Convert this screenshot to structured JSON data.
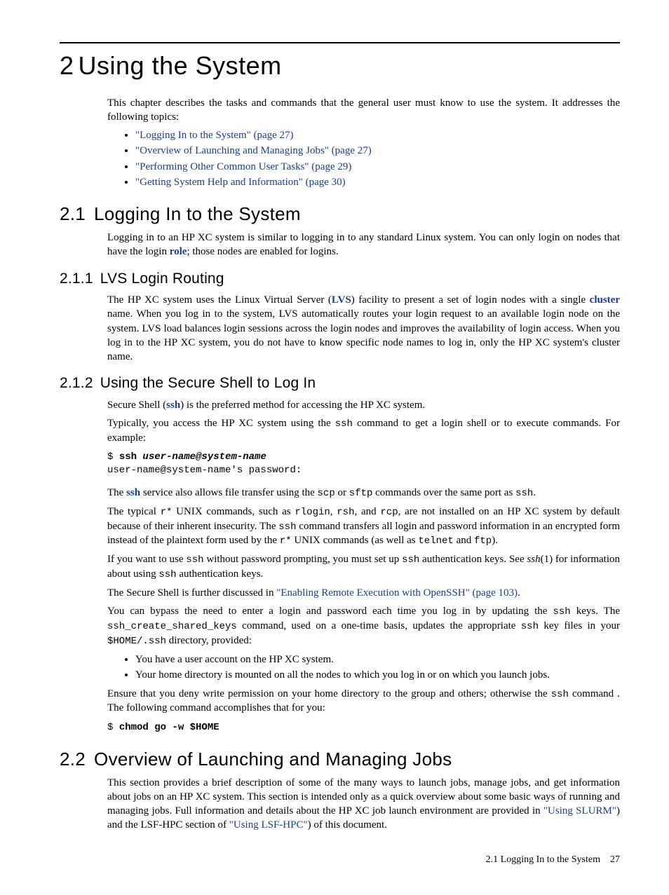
{
  "chapter": {
    "number": "2",
    "title": "Using the System",
    "intro": "This chapter describes the tasks and commands that the general user must know to use the system. It addresses the following topics:",
    "toc": [
      "\"Logging In to the System\" (page 27)",
      "\"Overview of Launching and Managing Jobs\" (page 27)",
      "\"Performing Other Common User Tasks\" (page 29)",
      "\"Getting System Help and Information\" (page 30)"
    ]
  },
  "s21": {
    "number": "2.1",
    "title": "Logging In to the System",
    "p1a": "Logging in to an HP XC system is similar to logging in to any standard Linux system. You can only login on nodes that have the login ",
    "p1_link": "role",
    "p1b": "; those nodes are enabled for logins."
  },
  "s211": {
    "number": "2.1.1",
    "title": "LVS Login Routing",
    "p1a": "The HP XC system uses the Linux Virtual Server (",
    "p1_lvs": "LVS",
    "p1b": ") facility to present a set of login nodes with a single ",
    "p1_cluster": "cluster",
    "p1c": " name. When you log in to the system, LVS automatically routes your login request to an available login node on the system. LVS load balances login sessions across the login nodes and improves the availability of login access. When you log in to the HP XC system, you do not have to know specific node names to log in, only the HP XC system's cluster name."
  },
  "s212": {
    "number": "2.1.2",
    "title": "Using the Secure Shell to Log In",
    "p1a": "Secure Shell (",
    "p1_ssh": "ssh",
    "p1b": ") is the preferred method for accessing the HP XC system.",
    "p2a": "Typically, you access the HP XC system using the ",
    "p2_ssh": "ssh",
    "p2b": " command to get a login shell or to execute commands. For example:",
    "code1_prompt": "$ ",
    "code1_cmd": "ssh ",
    "code1_arg": "user-name@system-name",
    "code1_out": "user-name@system-name's password:",
    "p3a": "The ",
    "p3_ssh": "ssh",
    "p3b": " service also allows file transfer using the ",
    "p3_scp": "scp",
    "p3c": " or ",
    "p3_sftp": "sftp",
    "p3d": " commands over the same port as ",
    "p3_ssh2": "ssh",
    "p3e": ".",
    "p4a": "The typical ",
    "p4_rstar": "r*",
    "p4b": " UNIX commands, such as ",
    "p4_rlogin": "rlogin",
    "p4c": ", ",
    "p4_rsh": "rsh",
    "p4d": ", and ",
    "p4_rcp": "rcp",
    "p4e": ", are not installed on an HP XC system by default because of their inherent insecurity. The ",
    "p4_ssh": "ssh",
    "p4f": " command transfers all login and password information in an encrypted form instead of the plaintext form used by the ",
    "p4_rstar2": "r*",
    "p4g": " UNIX commands (as well as ",
    "p4_telnet": "telnet",
    "p4h": " and ",
    "p4_ftp": "ftp",
    "p4i": ").",
    "p5a": "If you want to use ",
    "p5_ssh": "ssh",
    "p5b": " without password prompting, you must set up ",
    "p5_ssh2": "ssh",
    "p5c": " authentication keys. See ",
    "p5_sshman": "ssh",
    "p5d": "(1) for information about using ",
    "p5_ssh3": "ssh",
    "p5e": " authentication keys.",
    "p6a": "The Secure Shell is further discussed in ",
    "p6_link": "\"Enabling Remote Execution with OpenSSH\" (page 103)",
    "p6b": ".",
    "p7a": "You can bypass the need to enter a login and password each time you log in by updating the ",
    "p7_ssh": "ssh",
    "p7b": " keys. The ",
    "p7_cmd": "ssh_create_shared_keys",
    "p7c": " command, used on a one-time basis, updates the appropriate ",
    "p7_ssh2": "ssh",
    "p7d": " key files in your ",
    "p7_home": "$HOME/.ssh",
    "p7e": " directory, provided:",
    "bullets": [
      "You have a user account on the HP XC system.",
      "Your home directory is mounted on all the nodes to which you log in or on which you launch jobs."
    ],
    "p8a": "Ensure that you deny write permission on your home directory to the group and others; otherwise the ",
    "p8_ssh": "ssh",
    "p8b": " command . The following command accomplishes that for you:",
    "code2_prompt": "$ ",
    "code2_cmd": "chmod go -w $HOME"
  },
  "s22": {
    "number": "2.2",
    "title": "Overview of Launching and Managing Jobs",
    "p1a": "This section provides a brief description of some of the many ways to launch jobs, manage jobs, and get information about jobs on an HP XC system. This section is intended only as a quick overview about some basic ways of running and managing jobs. Full information and details about the HP XC job launch environment are provided in ",
    "p1_slurm": "\"Using SLURM\"",
    "p1b": ") and the LSF-HPC section of ",
    "p1_lsf": "\"Using LSF-HPC\"",
    "p1c": ") of this document."
  },
  "footer": {
    "section": "2.1 Logging In to the System",
    "page": "27"
  }
}
